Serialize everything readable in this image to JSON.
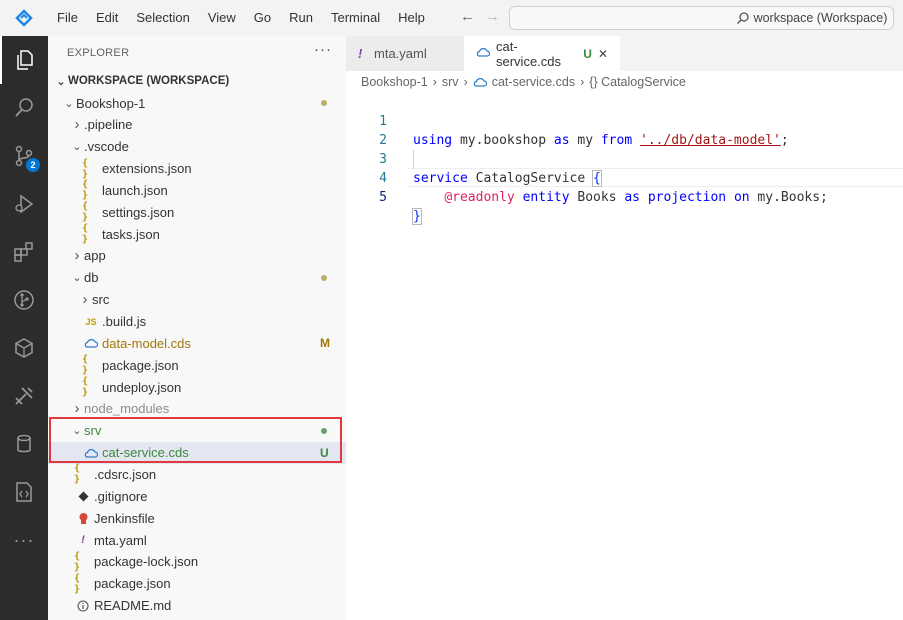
{
  "menu": [
    "File",
    "Edit",
    "Selection",
    "View",
    "Go",
    "Run",
    "Terminal",
    "Help"
  ],
  "search": {
    "text": "workspace (Workspace)"
  },
  "activity": {
    "icons": [
      "explorer-icon",
      "search-icon",
      "source-control-icon",
      "run-debug-icon",
      "extensions-icon",
      "git-graph-icon",
      "cube-icon",
      "tools-icon",
      "database-icon",
      "code-file-icon",
      "more-icon"
    ],
    "source_control_badge": "2"
  },
  "sidebar": {
    "title": "EXPLORER",
    "more": "···",
    "workspace_label": "WORKSPACE (WORKSPACE)",
    "items": [
      {
        "label": "Bookshop-1",
        "chev": "v",
        "icon": "",
        "status": "dot"
      },
      {
        "label": ".pipeline",
        "chev": ">",
        "icon": ""
      },
      {
        "label": ".vscode",
        "chev": "v",
        "icon": ""
      },
      {
        "label": "extensions.json",
        "chev": "",
        "icon": "{}"
      },
      {
        "label": "launch.json",
        "chev": "",
        "icon": "{}"
      },
      {
        "label": "settings.json",
        "chev": "",
        "icon": "{}"
      },
      {
        "label": "tasks.json",
        "chev": "",
        "icon": "{}"
      },
      {
        "label": "app",
        "chev": ">",
        "icon": ""
      },
      {
        "label": "db",
        "chev": "v",
        "icon": "",
        "status": "dot"
      },
      {
        "label": "src",
        "chev": ">",
        "icon": ""
      },
      {
        "label": ".build.js",
        "chev": "",
        "icon": "JS"
      },
      {
        "label": "data-model.cds",
        "chev": "",
        "icon": "cds",
        "status": "M"
      },
      {
        "label": "package.json",
        "chev": "",
        "icon": "{}"
      },
      {
        "label": "undeploy.json",
        "chev": "",
        "icon": "{}"
      },
      {
        "label": "node_modules",
        "chev": ">",
        "icon": ""
      },
      {
        "label": "srv",
        "chev": "v",
        "icon": "",
        "status": "dot-green"
      },
      {
        "label": "cat-service.cds",
        "chev": "",
        "icon": "cds",
        "status": "U"
      },
      {
        "label": ".cdsrc.json",
        "chev": "",
        "icon": "{}"
      },
      {
        "label": ".gitignore",
        "chev": "",
        "icon": "git"
      },
      {
        "label": "Jenkinsfile",
        "chev": "",
        "icon": "jenkins"
      },
      {
        "label": "mta.yaml",
        "chev": "",
        "icon": "!"
      },
      {
        "label": "package-lock.json",
        "chev": "",
        "icon": "{}"
      },
      {
        "label": "package.json",
        "chev": "",
        "icon": "{}"
      },
      {
        "label": "README.md",
        "chev": "",
        "icon": "info"
      }
    ]
  },
  "tabs": [
    {
      "label": "mta.yaml",
      "icon": "!"
    },
    {
      "label": "cat-service.cds",
      "status": "U",
      "close": "✕"
    }
  ],
  "breadcrumb": [
    "Bookshop-1",
    "srv",
    "cat-service.cds",
    "{} CatalogService"
  ],
  "code": {
    "line_numbers": [
      "1",
      "2",
      "3",
      "4",
      "5"
    ],
    "l1": {
      "kw1": "using",
      "t1": " my.bookshop ",
      "kw2": "as",
      "t2": " my ",
      "kw3": "from",
      "t3": " ",
      "str": "'../db/data-model'",
      "t4": ";"
    },
    "l3": {
      "kw1": "service",
      "t1": " CatalogService ",
      "brace": "{"
    },
    "l4": {
      "indent": "    ",
      "deco": "@readonly",
      "t0": " ",
      "kw1": "entity",
      "t1": " Books ",
      "kw2": "as",
      "t2": " ",
      "kw3": "projection",
      "t3": " ",
      "kw4": "on",
      "t4": " my.Books;"
    },
    "l5": {
      "brace": "}"
    }
  },
  "colors": {
    "accent": "#0078d4",
    "highlight_box": "#e03a3e",
    "modified": "#b8860b",
    "untracked": "#3c8a3c"
  }
}
